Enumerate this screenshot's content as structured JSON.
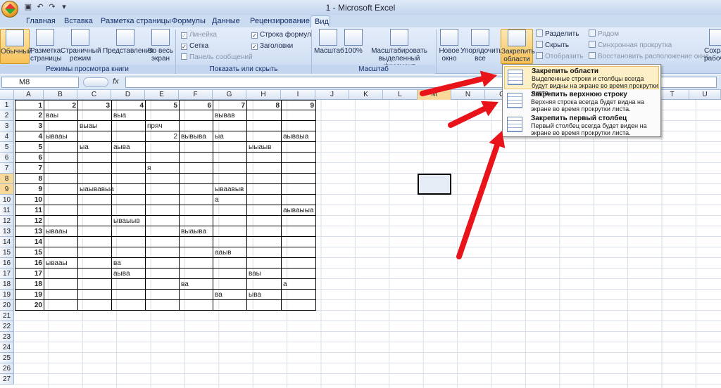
{
  "title": "1 - Microsoft Excel",
  "tabs": [
    "Главная",
    "Вставка",
    "Разметка страницы",
    "Формулы",
    "Данные",
    "Рецензирование",
    "Вид"
  ],
  "ribbon": {
    "views": {
      "normal": "Обычный",
      "page_layout": "Разметка страницы",
      "page_break": "Страничный режим",
      "custom": "Представления",
      "fullscreen": "Во весь экран",
      "label": "Режимы просмотра книги"
    },
    "show": {
      "ruler": "Линейка",
      "grid": "Сетка",
      "msg": "Панель сообщений",
      "formula_bar": "Строка формул",
      "headings": "Заголовки",
      "label": "Показать или скрыть"
    },
    "zoom": {
      "zoom": "Масштаб",
      "hundred": "100%",
      "selection": "Масштабировать выделенный фрагмент",
      "label": "Масштаб"
    },
    "window": {
      "new": "Новое окно",
      "arrange": "Упорядочить все",
      "freeze": "Закрепить области",
      "split": "Разделить",
      "hide": "Скрыть",
      "unhide": "Отобразить",
      "side": "Рядом",
      "sync": "Синхронная прокрутка",
      "reset": "Восстановить расположение окна",
      "workspace": "Сохранить рабочую"
    }
  },
  "formula": {
    "namebox": "M8",
    "fx": "fx"
  },
  "columns": [
    "A",
    "B",
    "C",
    "D",
    "E",
    "F",
    "G",
    "H",
    "I",
    "J",
    "K",
    "L",
    "M",
    "N",
    "O",
    "P",
    "Q",
    "R",
    "S",
    "T",
    "U"
  ],
  "rows": [
    "1",
    "2",
    "3",
    "4",
    "5",
    "6",
    "7",
    "8",
    "9",
    "10",
    "11",
    "12",
    "13",
    "14",
    "15",
    "16",
    "17",
    "18",
    "19",
    "20",
    "21",
    "22",
    "23",
    "24",
    "25",
    "26",
    "27"
  ],
  "cells": [
    {
      "r": 0,
      "c": 0,
      "v": "1",
      "n": true
    },
    {
      "r": 0,
      "c": 1,
      "v": "2",
      "n": true
    },
    {
      "r": 0,
      "c": 2,
      "v": "3",
      "n": true
    },
    {
      "r": 0,
      "c": 3,
      "v": "4",
      "n": true
    },
    {
      "r": 0,
      "c": 4,
      "v": "5",
      "n": true
    },
    {
      "r": 0,
      "c": 5,
      "v": "6",
      "n": true
    },
    {
      "r": 0,
      "c": 6,
      "v": "7",
      "n": true
    },
    {
      "r": 0,
      "c": 7,
      "v": "8",
      "n": true
    },
    {
      "r": 0,
      "c": 8,
      "v": "9",
      "n": true
    },
    {
      "r": 1,
      "c": 0,
      "v": "2",
      "n": true
    },
    {
      "r": 1,
      "c": 1,
      "v": "вaы"
    },
    {
      "r": 1,
      "c": 3,
      "v": "выа"
    },
    {
      "r": 1,
      "c": 6,
      "v": "вывав"
    },
    {
      "r": 2,
      "c": 0,
      "v": "3",
      "n": true
    },
    {
      "r": 2,
      "c": 2,
      "v": "выaы"
    },
    {
      "r": 2,
      "c": 4,
      "v": "пpяч"
    },
    {
      "r": 3,
      "c": 0,
      "v": "4",
      "n": true
    },
    {
      "r": 3,
      "c": 1,
      "v": "ываaы"
    },
    {
      "r": 3,
      "c": 4,
      "v": "2",
      "n": true
    },
    {
      "r": 3,
      "c": 5,
      "v": "вывыва"
    },
    {
      "r": 3,
      "c": 6,
      "v": "ыа"
    },
    {
      "r": 3,
      "c": 8,
      "v": "аываыа"
    },
    {
      "r": 4,
      "c": 0,
      "v": "5",
      "n": true
    },
    {
      "r": 4,
      "c": 2,
      "v": "ыа"
    },
    {
      "r": 4,
      "c": 3,
      "v": "аыва"
    },
    {
      "r": 4,
      "c": 7,
      "v": "ыыаыв"
    },
    {
      "r": 5,
      "c": 0,
      "v": "6",
      "n": true
    },
    {
      "r": 6,
      "c": 0,
      "v": "7",
      "n": true
    },
    {
      "r": 6,
      "c": 4,
      "v": "я"
    },
    {
      "r": 7,
      "c": 0,
      "v": "8",
      "n": true
    },
    {
      "r": 8,
      "c": 0,
      "v": "9",
      "n": true
    },
    {
      "r": 8,
      "c": 2,
      "v": "ыаывавыа"
    },
    {
      "r": 8,
      "c": 6,
      "v": "ываавыв"
    },
    {
      "r": 9,
      "c": 0,
      "v": "10",
      "n": true
    },
    {
      "r": 9,
      "c": 6,
      "v": "а"
    },
    {
      "r": 10,
      "c": 0,
      "v": "11",
      "n": true
    },
    {
      "r": 10,
      "c": 8,
      "v": "аываыыа"
    },
    {
      "r": 11,
      "c": 0,
      "v": "12",
      "n": true
    },
    {
      "r": 11,
      "c": 3,
      "v": "ываыыв"
    },
    {
      "r": 12,
      "c": 0,
      "v": "13",
      "n": true
    },
    {
      "r": 12,
      "c": 1,
      "v": "ываaы"
    },
    {
      "r": 12,
      "c": 5,
      "v": "выаыва"
    },
    {
      "r": 13,
      "c": 0,
      "v": "14",
      "n": true
    },
    {
      "r": 14,
      "c": 0,
      "v": "15",
      "n": true
    },
    {
      "r": 14,
      "c": 6,
      "v": "аaыв"
    },
    {
      "r": 15,
      "c": 0,
      "v": "16",
      "n": true
    },
    {
      "r": 15,
      "c": 1,
      "v": "ываaы"
    },
    {
      "r": 15,
      "c": 3,
      "v": "ва"
    },
    {
      "r": 16,
      "c": 0,
      "v": "17",
      "n": true
    },
    {
      "r": 16,
      "c": 3,
      "v": "аыва"
    },
    {
      "r": 16,
      "c": 7,
      "v": "ваы"
    },
    {
      "r": 17,
      "c": 0,
      "v": "18",
      "n": true
    },
    {
      "r": 17,
      "c": 5,
      "v": "ва"
    },
    {
      "r": 17,
      "c": 8,
      "v": "а"
    },
    {
      "r": 18,
      "c": 0,
      "v": "19",
      "n": true
    },
    {
      "r": 18,
      "c": 6,
      "v": "ва"
    },
    {
      "r": 18,
      "c": 7,
      "v": "ыва"
    },
    {
      "r": 19,
      "c": 0,
      "v": "20",
      "n": true
    }
  ],
  "menu": [
    {
      "title": "Закрепить области",
      "desc": "Выделенные строки и столбцы всегда будут видны на экране во время прокрутки листа."
    },
    {
      "title": "Закрепить верхнюю строку",
      "desc": "Верхняя строка всегда будет видна на экране во время прокрутки листа."
    },
    {
      "title": "Закрепить первый столбец",
      "desc": "Первый столбец всегда будет виден на экране во время прокрутки листа."
    }
  ],
  "colors": {
    "arrow": "#e8141a",
    "highlight": "#f7c158"
  }
}
